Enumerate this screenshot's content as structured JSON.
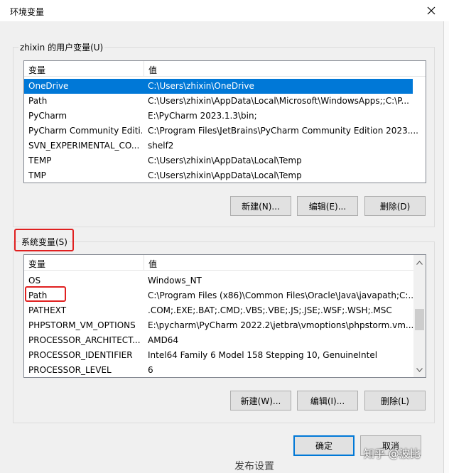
{
  "window": {
    "title": "环境变量"
  },
  "user_vars": {
    "group_label": "zhixin 的用户变量(U)",
    "col_name": "变量",
    "col_value": "值",
    "rows": [
      {
        "name": "OneDrive",
        "value": "C:\\Users\\zhixin\\OneDrive"
      },
      {
        "name": "Path",
        "value": "C:\\Users\\zhixin\\AppData\\Local\\Microsoft\\WindowsApps;;C:\\P..."
      },
      {
        "name": "PyCharm",
        "value": "E:\\PyCharm 2023.1.3\\bin;"
      },
      {
        "name": "PyCharm Community Editi...",
        "value": "C:\\Program Files\\JetBrains\\PyCharm Community Edition 2023...."
      },
      {
        "name": "SVN_EXPERIMENTAL_CO...",
        "value": "shelf2"
      },
      {
        "name": "TEMP",
        "value": "C:\\Users\\zhixin\\AppData\\Local\\Temp"
      },
      {
        "name": "TMP",
        "value": "C:\\Users\\zhixin\\AppData\\Local\\Temp"
      }
    ],
    "new_label": "新建(N)...",
    "edit_label": "编辑(E)...",
    "delete_label": "删除(D)"
  },
  "sys_vars": {
    "group_label": "系统变量(S)",
    "col_name": "变量",
    "col_value": "值",
    "rows": [
      {
        "name": "OS",
        "value": "Windows_NT"
      },
      {
        "name": "Path",
        "value": "C:\\Program Files (x86)\\Common Files\\Oracle\\Java\\javapath;C:..."
      },
      {
        "name": "PATHEXT",
        "value": ".COM;.EXE;.BAT;.CMD;.VBS;.VBE;.JS;.JSE;.WSF;.WSH;.MSC"
      },
      {
        "name": "PHPSTORM_VM_OPTIONS",
        "value": "E:\\pycharm\\PyCharm 2022.2\\jetbra\\vmoptions\\phpstorm.vm..."
      },
      {
        "name": "PROCESSOR_ARCHITECT...",
        "value": "AMD64"
      },
      {
        "name": "PROCESSOR_IDENTIFIER",
        "value": "Intel64 Family 6 Model 158 Stepping 10, GenuineIntel"
      },
      {
        "name": "PROCESSOR_LEVEL",
        "value": "6"
      }
    ],
    "new_label": "新建(W)...",
    "edit_label": "编辑(I)...",
    "delete_label": "删除(L)"
  },
  "footer": {
    "ok_label": "确定",
    "cancel_label": "取消"
  },
  "watermark": "知乎 @波比",
  "background_text": "发布设置"
}
